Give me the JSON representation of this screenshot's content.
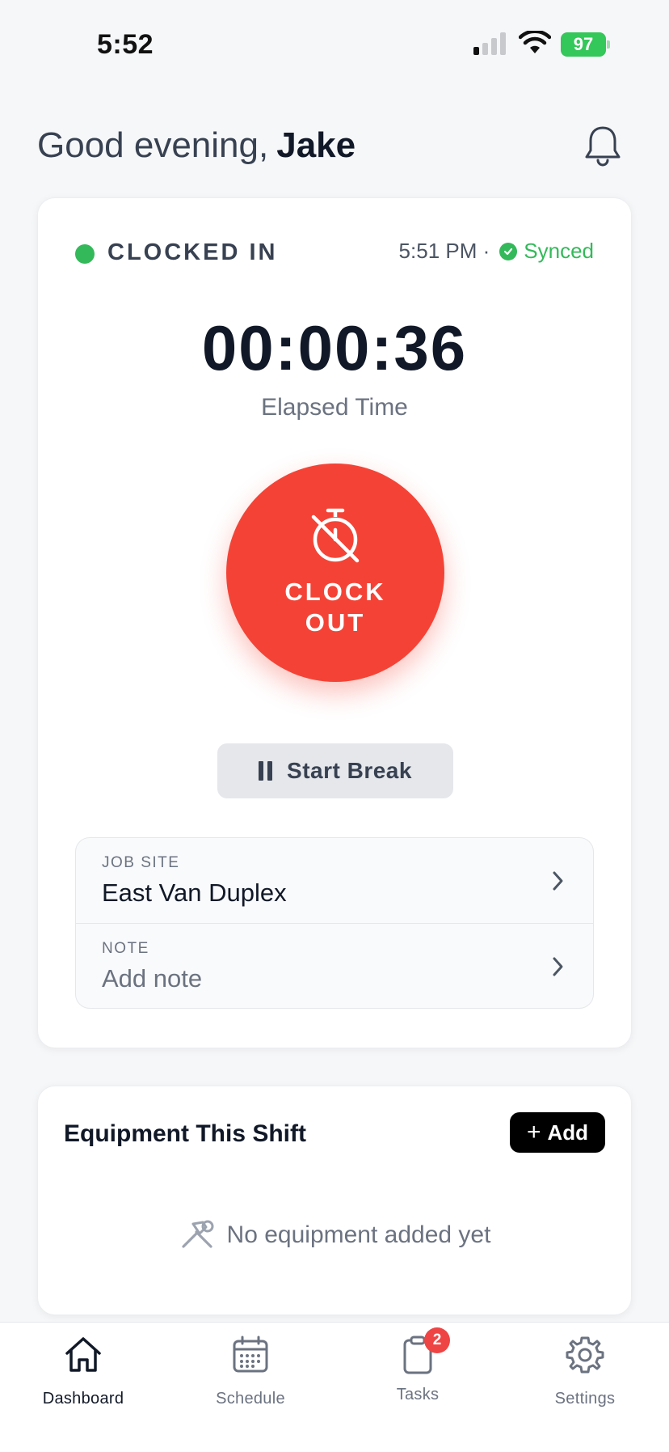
{
  "status_bar": {
    "time": "5:52",
    "battery": "97",
    "signal_bars_on": 1,
    "signal_bars_total": 4
  },
  "header": {
    "greeting": "Good evening,",
    "user_name": "Jake",
    "bell_icon": "bell-icon"
  },
  "clock_card": {
    "status": "CLOCKED IN",
    "clock_in_time": "5:51 PM ·",
    "sync_status": "Synced",
    "timer": "00:00:36",
    "timer_label": "Elapsed Time",
    "clock_button_label": "CLOCK\nOUT",
    "clock_button_icon": "timer-off-icon",
    "break_button_label": "Start Break",
    "job_site": {
      "label": "JOB SITE",
      "value": "East Van Duplex"
    },
    "note": {
      "label": "NOTE",
      "placeholder": "Add note"
    }
  },
  "equipment": {
    "title": "Equipment This Shift",
    "add_label": "Add",
    "empty_text": "No equipment added yet",
    "empty_icon": "tools-icon"
  },
  "tabs": [
    {
      "label": "Dashboard",
      "icon": "home-icon",
      "active": true
    },
    {
      "label": "Schedule",
      "icon": "calendar-icon",
      "active": false
    },
    {
      "label": "Tasks",
      "icon": "clipboard-icon",
      "active": false,
      "badge": "2"
    },
    {
      "label": "Settings",
      "icon": "gear-icon",
      "active": false
    }
  ],
  "colors": {
    "accent_red": "#f44336",
    "status_green": "#34b95a",
    "background": "#f6f7f9"
  }
}
